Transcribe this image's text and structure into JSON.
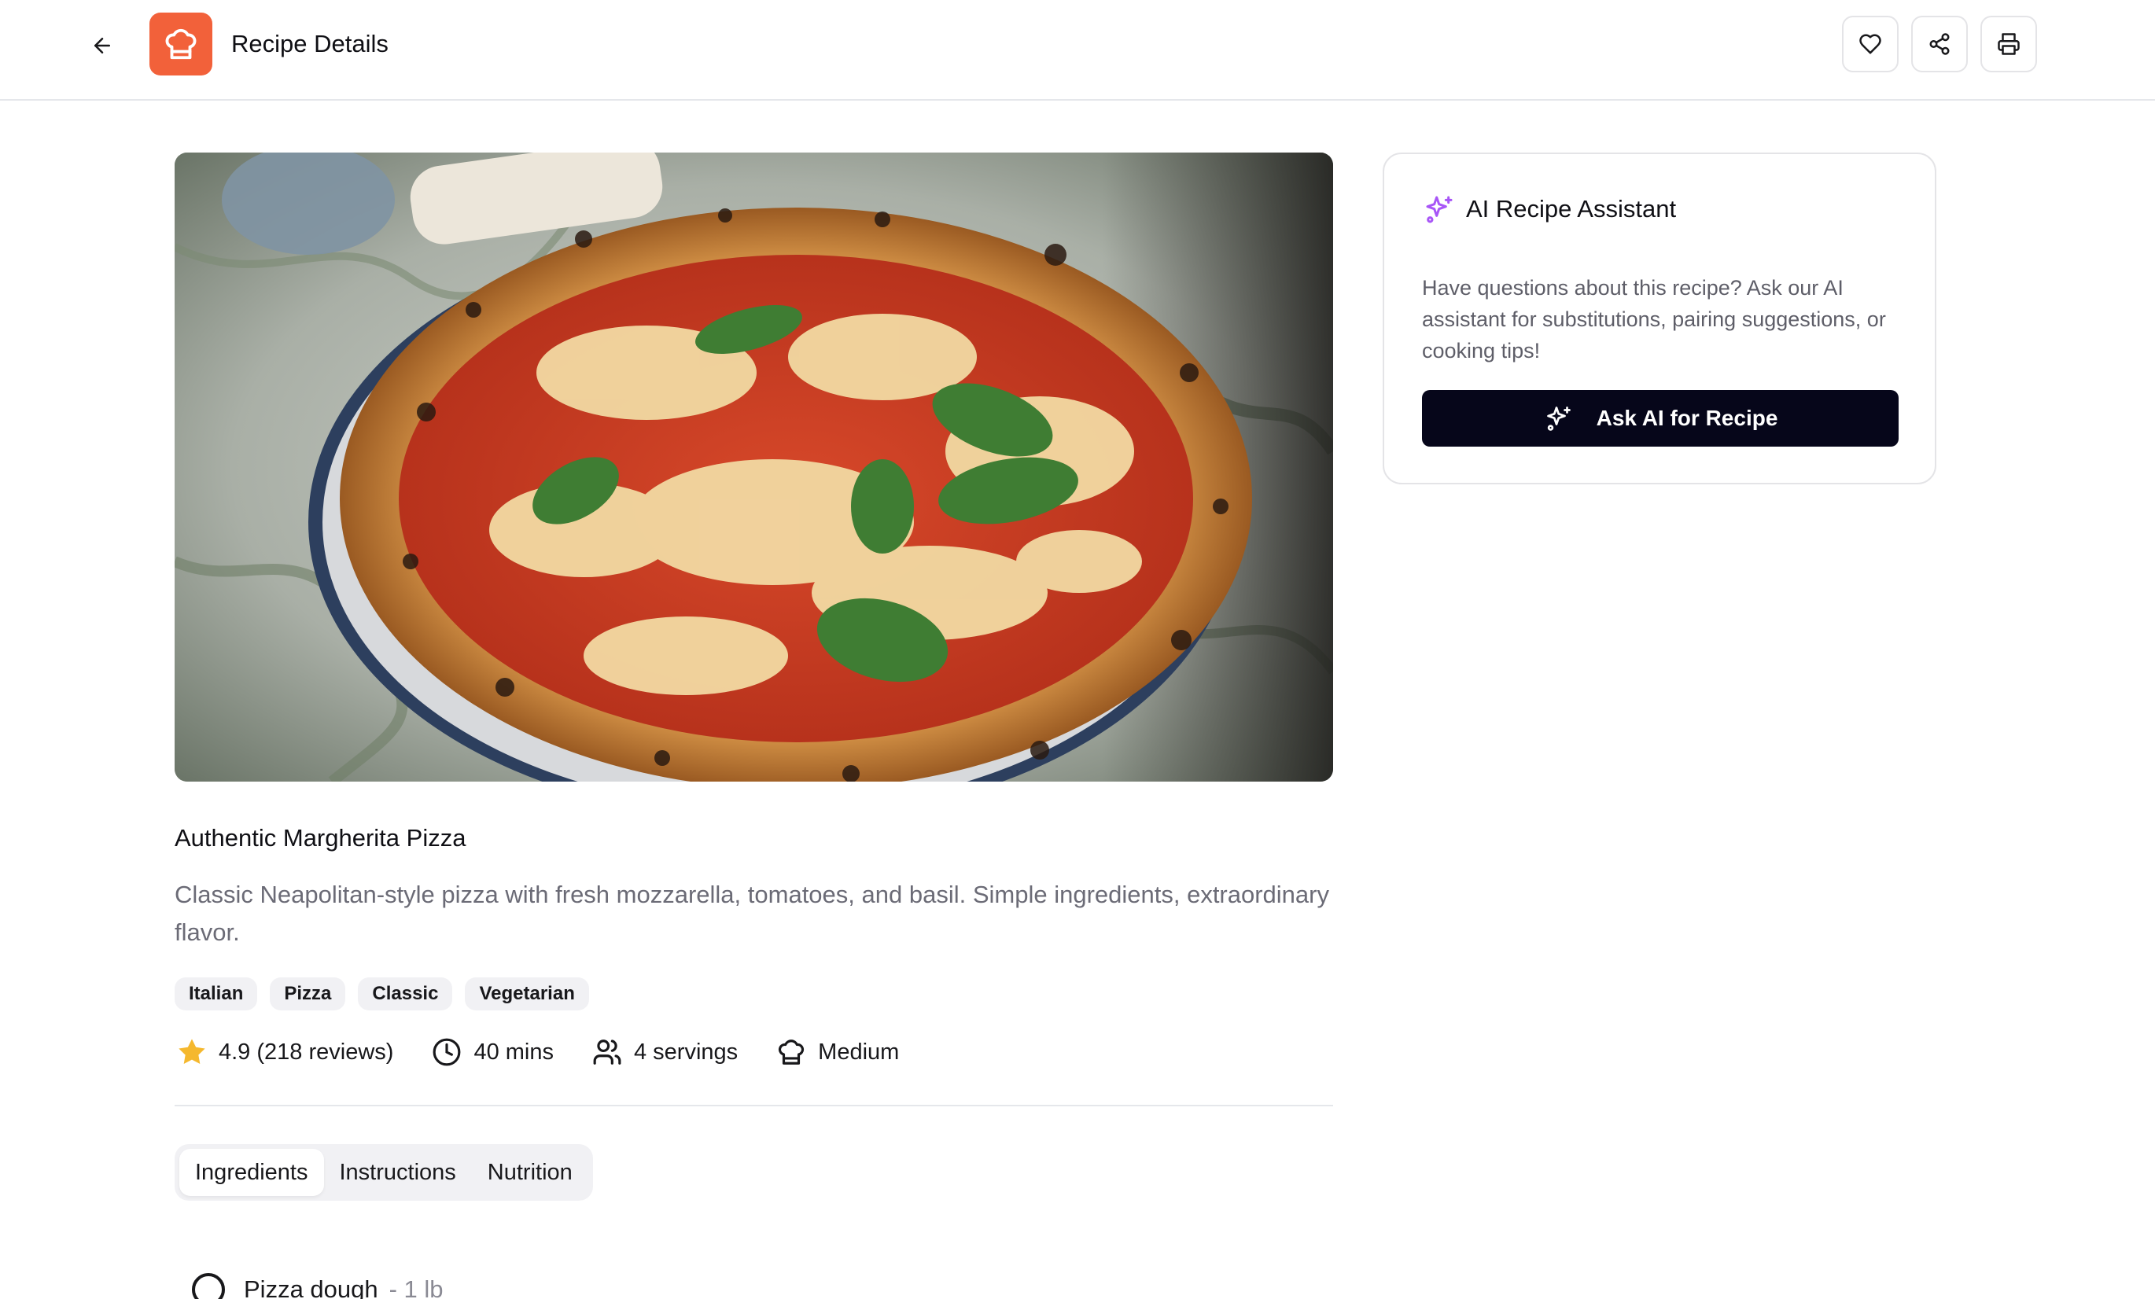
{
  "header": {
    "title": "Recipe Details",
    "back_icon": "arrow-left-icon",
    "logo_icon": "chef-hat-icon",
    "actions": [
      {
        "name": "favorite",
        "icon": "heart-icon"
      },
      {
        "name": "share",
        "icon": "share-icon"
      },
      {
        "name": "print",
        "icon": "printer-icon"
      }
    ]
  },
  "recipe": {
    "image_alt": "Margherita pizza on a plate",
    "title": "Authentic Margherita Pizza",
    "description": "Classic Neapolitan-style pizza with fresh mozzarella, tomatoes, and basil. Simple ingredients, extraordinary flavor.",
    "tags": [
      "Italian",
      "Pizza",
      "Classic",
      "Vegetarian"
    ],
    "meta": {
      "rating": "4.9 (218 reviews)",
      "time": "40 mins",
      "servings": "4 servings",
      "difficulty": "Medium"
    }
  },
  "tabs": {
    "items": [
      "Ingredients",
      "Instructions",
      "Nutrition"
    ],
    "active": "Ingredients"
  },
  "ingredients": [
    {
      "name": "Pizza dough",
      "quantity": "- 1 lb",
      "checked": false
    }
  ],
  "ai_assistant": {
    "title": "AI Recipe Assistant",
    "description": "Have questions about this recipe? Ask our AI assistant for substitutions, pairing suggestions, or cooking tips!",
    "button_label": "Ask AI for Recipe",
    "accent_color": "#a855f7"
  },
  "colors": {
    "brand": "#f2613a",
    "primary_button": "#06061a",
    "star": "#f5b82e"
  }
}
